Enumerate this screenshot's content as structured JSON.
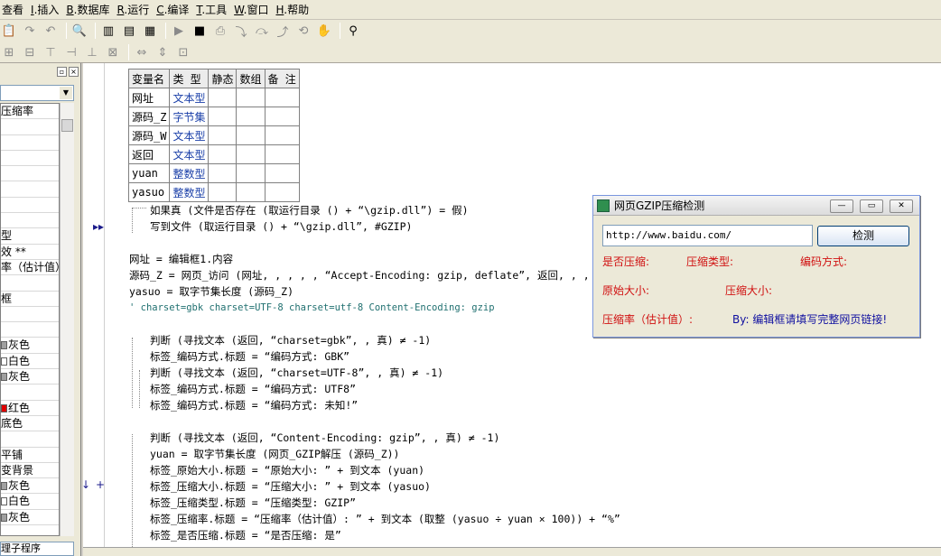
{
  "menu": [
    {
      "key": "",
      "label": "查看"
    },
    {
      "key": "I",
      "label": ".插入"
    },
    {
      "key": "B",
      "label": ".数据库"
    },
    {
      "key": "R",
      "label": ".运行"
    },
    {
      "key": "C",
      "label": ".编译"
    },
    {
      "key": "T",
      "label": ".工具"
    },
    {
      "key": "W",
      "label": ".窗口"
    },
    {
      "key": "H",
      "label": ".帮助"
    }
  ],
  "left_panel": {
    "list_items": [
      "压缩率",
      "",
      "",
      "",
      "",
      "",
      "",
      "",
      "型",
      "效 **",
      "率（估计值）",
      "",
      "框",
      "",
      "",
      "灰色",
      "白色",
      "灰色",
      "",
      "红色",
      "底色",
      "",
      "平铺",
      "变背景",
      "灰色",
      "白色",
      "灰色"
    ],
    "swatch_colors": {
      "灰色": "#a0a0a0",
      "白色": "#ffffff",
      "红色": "#e00000"
    },
    "bottom_label": "理子程序"
  },
  "var_table": {
    "headers": [
      "变量名",
      "类 型",
      "静态",
      "数组",
      "备 注"
    ],
    "rows": [
      [
        "网址",
        "文本型",
        "",
        "",
        ""
      ],
      [
        "源码_Z",
        "字节集",
        "",
        "",
        ""
      ],
      [
        "源码_W",
        "文本型",
        "",
        "",
        ""
      ],
      [
        "返回",
        "文本型",
        "",
        "",
        ""
      ],
      [
        "yuan",
        "整数型",
        "",
        "",
        ""
      ],
      [
        "yasuo",
        "整数型",
        "",
        "",
        ""
      ]
    ]
  },
  "code": {
    "l1": "如果真 (文件是否存在 (取运行目录 () + “\\gzip.dll”) = 假)",
    "l2": "写到文件 (取运行目录 () + “\\gzip.dll”, #GZIP)",
    "l3": "网址 = 编辑框1.内容",
    "l4": "源码_Z = 网页_访问 (网址, , , , , “Accept-Encoding: gzip, deflate”, 返回, , , )",
    "l5": "yasuo = 取字节集长度 (源码_Z)",
    "l6": "' charset=gbk charset=UTF-8 charset=utf-8 Content-Encoding: gzip",
    "l7": "判断 (寻找文本 (返回, “charset=gbk”, , 真) ≠ -1)",
    "l8": "标签_编码方式.标题 = “编码方式: GBK”",
    "l9": "判断 (寻找文本 (返回, “charset=UTF-8”, , 真) ≠ -1)",
    "l10": "标签_编码方式.标题 = “编码方式: UTF8”",
    "l11": "标签_编码方式.标题 = “编码方式: 未知!”",
    "l12": "判断 (寻找文本 (返回, “Content-Encoding: gzip”, , 真) ≠ -1)",
    "l13": "yuan = 取字节集长度 (网页_GZIP解压 (源码_Z))",
    "l14": "标签_原始大小.标题 = “原始大小: ” + 到文本 (yuan)",
    "l15": "标签_压缩大小.标题 = “压缩大小: ” + 到文本 (yasuo)",
    "l16": "标签_压缩类型.标题 = “压缩类型: GZIP”",
    "l17": "标签_压缩率.标题 = “压缩率（估计值）: ” + 到文本 (取整 (yasuo ÷ yuan × 100)) + “%”",
    "l18": "标签_是否压缩.标题 = “是否压缩: 是”"
  },
  "gzip_window": {
    "title": "网页GZIP压缩检测",
    "url_value": "http://www.baidu.com/",
    "detect_button": "检测",
    "lbl_compressed": "是否压缩:",
    "lbl_type": "压缩类型:",
    "lbl_encoding": "编码方式:",
    "lbl_original": "原始大小:",
    "lbl_size": "压缩大小:",
    "lbl_ratio": "压缩率（估计值）:",
    "info": "By: 编辑框请填写完整网页链接!"
  },
  "colors": {
    "keyword": "#1a3fa8",
    "label": "#d01010",
    "info": "#1010a0"
  }
}
